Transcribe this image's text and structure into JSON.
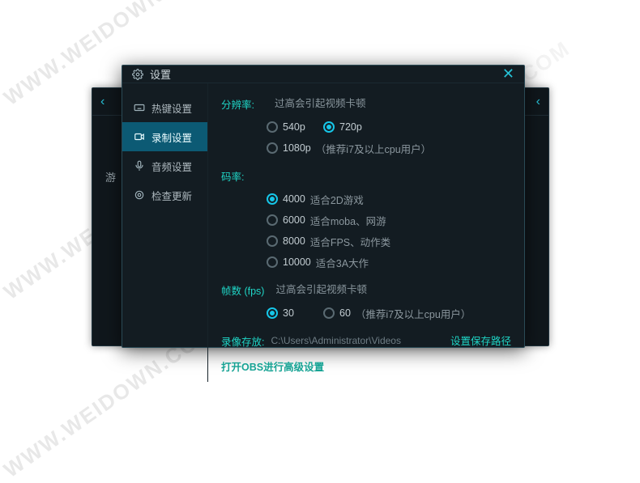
{
  "watermark": "WWW.WEIDOWN.COM",
  "back_window": {
    "partial_label": "游"
  },
  "dialog": {
    "title": "设置",
    "sidebar": {
      "items": [
        {
          "label": "热键设置"
        },
        {
          "label": "录制设置"
        },
        {
          "label": "音频设置"
        },
        {
          "label": "检查更新"
        }
      ],
      "active_index": 1
    },
    "content": {
      "resolution": {
        "label": "分辨率:",
        "hint": "过高会引起视频卡顿",
        "options": [
          {
            "value": "540p",
            "note": ""
          },
          {
            "value": "720p",
            "note": ""
          },
          {
            "value": "1080p",
            "note": "（推荐i7及以上cpu用户）"
          }
        ],
        "selected_index": 1
      },
      "bitrate": {
        "label": "码率:",
        "options": [
          {
            "value": "4000",
            "note": "适合2D游戏"
          },
          {
            "value": "6000",
            "note": "适合moba、网游"
          },
          {
            "value": "8000",
            "note": "适合FPS、动作类"
          },
          {
            "value": "10000",
            "note": "适合3A大作"
          }
        ],
        "selected_index": 0
      },
      "fps": {
        "label": "帧数 (fps)",
        "hint": "过高会引起视频卡顿",
        "options": [
          {
            "value": "30",
            "note": ""
          },
          {
            "value": "60",
            "note": "（推荐i7及以上cpu用户）"
          }
        ],
        "selected_index": 0
      },
      "save_path": {
        "label": "录像存放:",
        "path": "C:\\Users\\Administrator\\Videos",
        "set_link": "设置保存路径"
      },
      "advanced_link": "打开OBS进行高级设置"
    }
  }
}
